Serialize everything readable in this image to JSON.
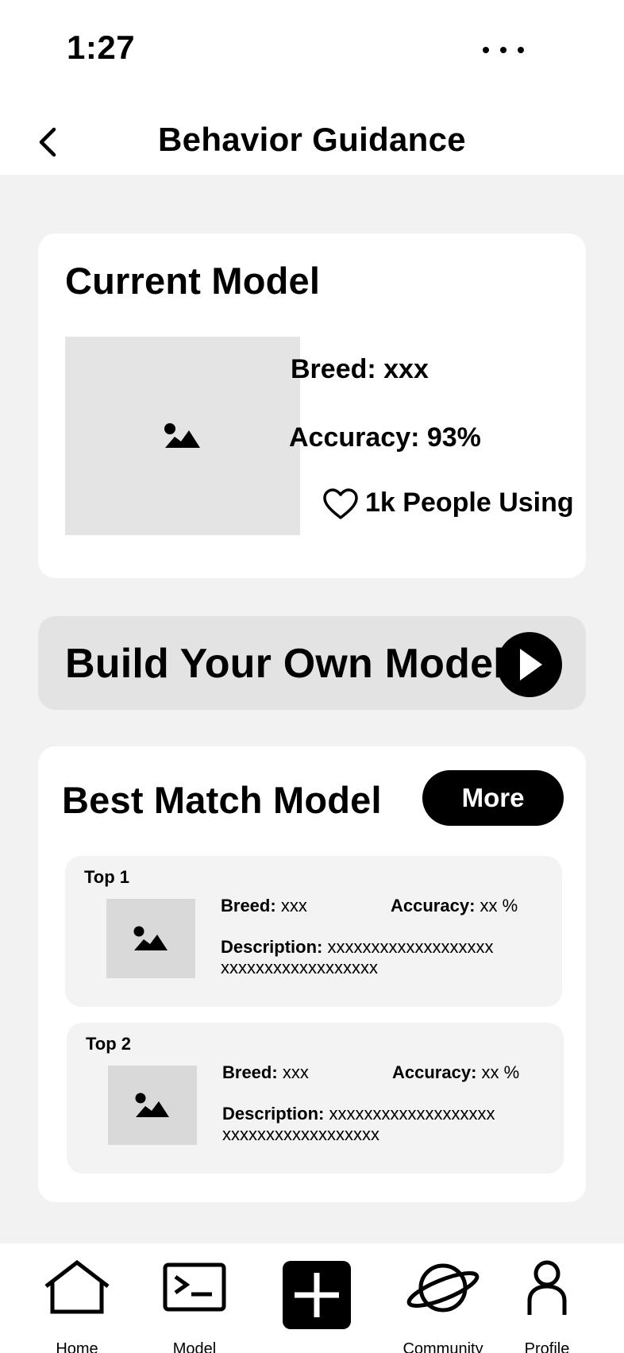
{
  "status": {
    "time": "1:27"
  },
  "header": {
    "title": "Behavior Guidance"
  },
  "current_model": {
    "title": "Current Model",
    "breed": "Breed: xxx",
    "accuracy": "Accuracy: 93%",
    "users": "1k People Using"
  },
  "build": {
    "label": "Build Your Own Model"
  },
  "best_match": {
    "title": "Best Match Model",
    "more_label": "More",
    "results": [
      {
        "rank": "Top 1",
        "breed_label": "Breed:",
        "breed_value": "xxx",
        "accuracy_label": "Accuracy:",
        "accuracy_value": "xx %",
        "description_label": "Description:",
        "description_line1": "xxxxxxxxxxxxxxxxxxx",
        "description_line2": "xxxxxxxxxxxxxxxxxx"
      },
      {
        "rank": "Top 2",
        "breed_label": "Breed:",
        "breed_value": "xxx",
        "accuracy_label": "Accuracy:",
        "accuracy_value": "xx %",
        "description_label": "Description:",
        "description_line1": "xxxxxxxxxxxxxxxxxxx",
        "description_line2": "xxxxxxxxxxxxxxxxxx"
      }
    ]
  },
  "nav": {
    "items": [
      {
        "label": "Home",
        "icon": "home-icon"
      },
      {
        "label": "Model",
        "icon": "terminal-icon"
      },
      {
        "label": "",
        "icon": "plus-icon"
      },
      {
        "label": "Community",
        "icon": "planet-icon"
      },
      {
        "label": "Profile",
        "icon": "user-icon"
      }
    ]
  }
}
